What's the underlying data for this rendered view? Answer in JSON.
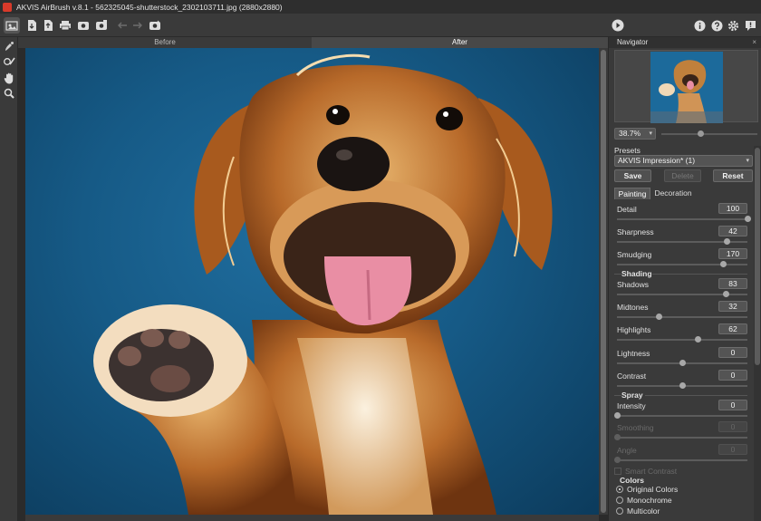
{
  "window": {
    "title": "AKVIS AirBrush v.8.1 - 562325045-shutterstock_2302103711.jpg (2880x2880)",
    "controls": [
      "–",
      "☐",
      "✕"
    ]
  },
  "toolbar": {
    "icons": [
      "open-image-icon",
      "import-icon",
      "export-icon",
      "save-icon",
      "print-icon",
      "share-icon",
      "undo-icon",
      "redo-icon",
      "batch-icon",
      "run-icon",
      "info-icon",
      "help-icon",
      "settings-icon",
      "notifications-icon"
    ]
  },
  "left_tools": [
    "hand-brush-icon",
    "retouch-brush-icon",
    "hand-tool-icon",
    "zoom-tool-icon"
  ],
  "canvas": {
    "tab_before": "Before",
    "tab_after": "After"
  },
  "navigator": {
    "title": "Navigator",
    "close": "×",
    "zoom": "38.7%",
    "zoom_arrow": "▾"
  },
  "presets": {
    "label": "Presets",
    "selected": "AKVIS Impression* (1)",
    "arrow": "▾",
    "save": "Save",
    "delete": "Delete",
    "reset": "Reset"
  },
  "tabs": {
    "painting": "Painting",
    "decoration": "Decoration"
  },
  "params": {
    "detail": {
      "label": "Detail",
      "value": "100",
      "fraction": 1.0
    },
    "sharpness": {
      "label": "Sharpness",
      "value": "42",
      "fraction": 0.84
    },
    "smudging": {
      "label": "Smudging",
      "value": "170",
      "fraction": 0.81
    },
    "shading_title": "Shading",
    "shadows": {
      "label": "Shadows",
      "value": "83",
      "fraction": 0.83
    },
    "midtones": {
      "label": "Midtones",
      "value": "32",
      "fraction": 0.32
    },
    "highlights": {
      "label": "Highlights",
      "value": "62",
      "fraction": 0.62
    },
    "lightness": {
      "label": "Lightness",
      "value": "0",
      "fraction": 0.5
    },
    "contrast": {
      "label": "Contrast",
      "value": "0",
      "fraction": 0.5
    },
    "spray_title": "Spray",
    "intensity": {
      "label": "Intensity",
      "value": "0",
      "fraction": 0.0
    },
    "smoothing": {
      "label": "Smoothing",
      "value": "0",
      "fraction": 0.0
    },
    "angle": {
      "label": "Angle",
      "value": "0",
      "fraction": 0.0
    },
    "smart_contrast": "Smart Contrast"
  },
  "colors": {
    "title": "Colors",
    "options": [
      "Original Colors",
      "Monochrome",
      "Multicolor"
    ],
    "selected": "Original Colors"
  }
}
